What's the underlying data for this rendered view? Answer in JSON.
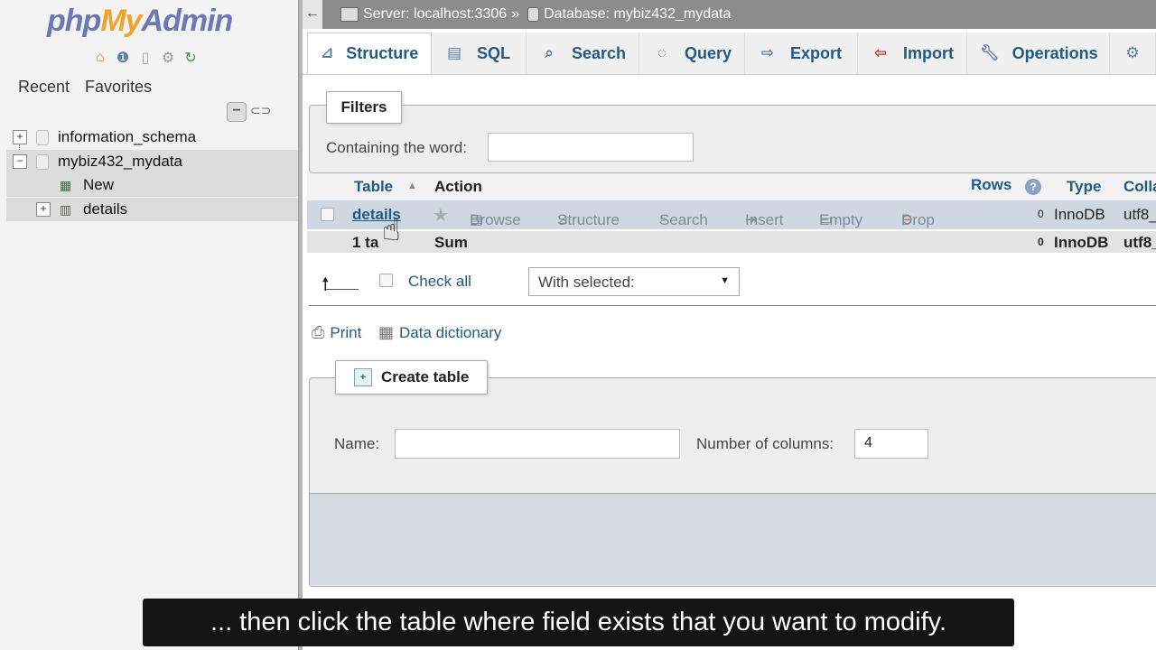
{
  "navigation": {
    "logo": {
      "part1": "php",
      "part2": "My",
      "part3": "Admin"
    },
    "quick_icons": [
      "home-icon",
      "help-icon",
      "docs-icon",
      "settings-icon",
      "reload-icon"
    ],
    "recent_label": "Recent",
    "favorites_label": "Favorites",
    "tree": [
      {
        "label": "information_schema",
        "expander": "+"
      },
      {
        "label": "mybiz432_mydata",
        "expander": "−",
        "selected": true
      },
      {
        "label": "New"
      },
      {
        "label": "details",
        "expander": "+"
      }
    ]
  },
  "topbar": {
    "back": "←",
    "server": "Server: localhost:3306",
    "separator": "»",
    "database": "Database: mybiz432_mydata"
  },
  "tabs": [
    {
      "label": "Structure",
      "icon": "structure-icon",
      "active": true
    },
    {
      "label": "SQL",
      "icon": "sql-icon"
    },
    {
      "label": "Search",
      "icon": "search-icon"
    },
    {
      "label": "Query",
      "icon": "query-icon"
    },
    {
      "label": "Export",
      "icon": "export-icon"
    },
    {
      "label": "Import",
      "icon": "import-icon"
    },
    {
      "label": "Operations",
      "icon": "wrench-icon"
    }
  ],
  "filters": {
    "legend": "Filters",
    "containing_label": "Containing the word:",
    "containing_value": ""
  },
  "table_list": {
    "headers": {
      "table": "Table",
      "sort": "▲",
      "action": "Action",
      "rows": "Rows",
      "type": "Type",
      "collation": "Colla"
    },
    "row": {
      "name": "details",
      "actions": [
        "Browse",
        "Structure",
        "Search",
        "Insert",
        "Empty",
        "Drop"
      ],
      "rows": "0",
      "type": "InnoDB",
      "collation": "utf8_"
    },
    "sum": {
      "count": "1 ta",
      "label": "Sum",
      "rows": "0",
      "type": "InnoDB",
      "collation": "utf8_"
    }
  },
  "bulk": {
    "check_all": "Check all",
    "with_selected": "With selected:"
  },
  "links": {
    "print": "Print",
    "data_dictionary": "Data dictionary"
  },
  "create_table": {
    "legend": "Create table",
    "name_label": "Name:",
    "name_value": "",
    "columns_label": "Number of columns:",
    "columns_value": "4"
  },
  "subtitle": "... then click the table where field exists that you want to modify."
}
